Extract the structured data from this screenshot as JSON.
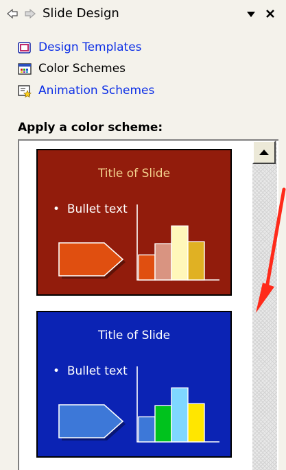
{
  "header": {
    "title": "Slide Design",
    "back_icon": "back-arrow-icon",
    "forward_icon": "forward-arrow-icon",
    "menu_icon": "dropdown-arrow-icon",
    "close_icon": "close-icon"
  },
  "links": [
    {
      "label": "Design Templates",
      "icon": "design-templates-icon",
      "color": "#0b2ee6"
    },
    {
      "label": "Color Schemes",
      "icon": "color-schemes-icon",
      "color": "#000000"
    },
    {
      "label": "Animation Schemes",
      "icon": "animation-schemes-icon",
      "color": "#0b2ee6"
    }
  ],
  "section_label": "Apply a color scheme:",
  "schemes": [
    {
      "title": "Title of Slide",
      "bullet": "Bullet text",
      "bullet_glyph": "•",
      "colors": {
        "background": "#921c0c",
        "title": "#f3d28e",
        "arrow": "#e04f10",
        "bars": [
          "#e04f10",
          "#d99481",
          "#fff7ba",
          "#e0b123"
        ]
      },
      "bar_values": [
        0.38,
        0.55,
        0.82,
        0.58
      ]
    },
    {
      "title": "Title of Slide",
      "bullet": "Bullet text",
      "bullet_glyph": "•",
      "colors": {
        "background": "#0b23b4",
        "title": "#ffffff",
        "arrow": "#3d78d8",
        "bars": [
          "#3d78d8",
          "#00c21d",
          "#7fd7ff",
          "#ffe600"
        ]
      },
      "bar_values": [
        0.38,
        0.55,
        0.82,
        0.58
      ]
    }
  ],
  "annotation_color": "#ff2a1a"
}
